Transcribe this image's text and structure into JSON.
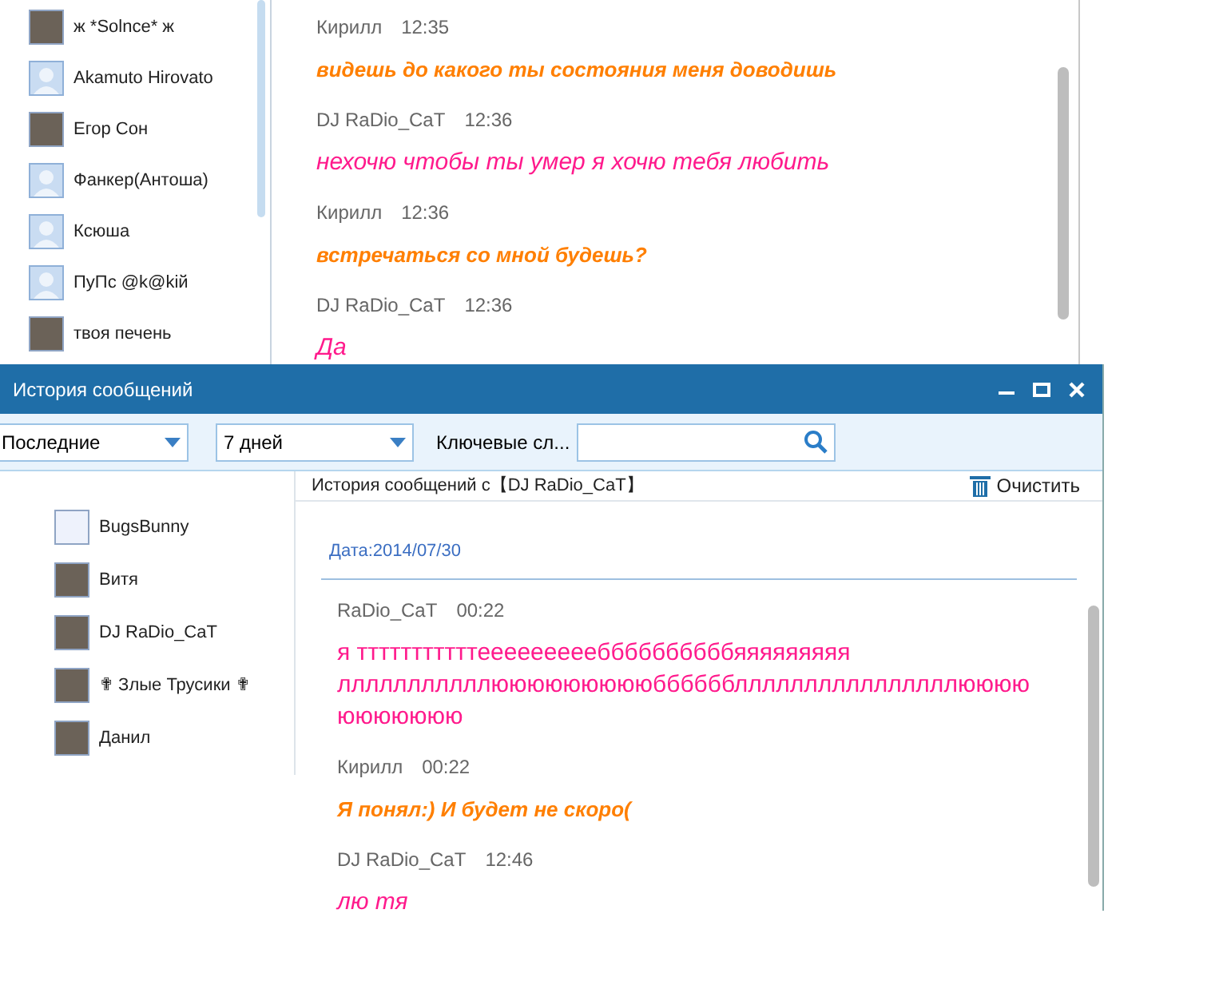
{
  "back_window": {
    "contacts": [
      {
        "name": "ж *Solnce* ж",
        "kind": "photo"
      },
      {
        "name": "Akamuto Hirovato",
        "kind": "default"
      },
      {
        "name": "Егор Сон",
        "kind": "photo"
      },
      {
        "name": "Фанкер(Антоша)",
        "kind": "default"
      },
      {
        "name": "Ксюша",
        "kind": "default"
      },
      {
        "name": "ПуПс @k@kiй",
        "kind": "default"
      },
      {
        "name": "твоя печень",
        "kind": "photo"
      }
    ],
    "messages": [
      {
        "sender": "Кирилл",
        "time": "12:35",
        "text": "видешь до какого ты состояния меня доводишь",
        "color": "#ff7f00",
        "kind": "bold-italic"
      },
      {
        "sender": "DJ RaDio_CaT",
        "time": "12:36",
        "text": "нехочю чтобы ты умер я хочю тебя любить",
        "color": "#ff1a8c",
        "kind": "italic"
      },
      {
        "sender": "Кирилл",
        "time": "12:36",
        "text": "встречаться со мной будешь?",
        "color": "#ff7f00",
        "kind": "bold-italic"
      },
      {
        "sender": "DJ RaDio_CaT",
        "time": "12:36",
        "text": "Да",
        "color": "#ff1a8c",
        "kind": "italic"
      }
    ]
  },
  "history_window": {
    "title": "История сообщений",
    "filter": {
      "value": "Последние"
    },
    "period": {
      "value": "7 дней"
    },
    "keywords_label": "Ключевые сл...",
    "contacts": [
      {
        "name": "BugsBunny",
        "kind": "blank"
      },
      {
        "name": "Витя",
        "kind": "photo"
      },
      {
        "name": "DJ RaDio_CaT",
        "kind": "photo"
      },
      {
        "name": "✟ Злые Трусики ✟",
        "kind": "photo"
      },
      {
        "name": "Данил",
        "kind": "photo"
      }
    ],
    "header": "История сообщений с【DJ RaDio_CaT】",
    "clear_button": "Очистить",
    "date": "Дата:2014/07/30",
    "messages": [
      {
        "sender": "RaDio_CaT",
        "time": "00:22",
        "text": "я тттттттттттеееееееееббббббббббяяяяяяяяя лллллллллллюююююююююббббббллллллллллллллллюююю ююююююю",
        "color": "#ff1a8c",
        "kind": "regular"
      },
      {
        "sender": "Кирилл",
        "time": "00:22",
        "text": "Я понял:) И будет не скоро(",
        "color": "#ff7f00",
        "kind": "bold-italic"
      },
      {
        "sender": "DJ RaDio_CaT",
        "time": "12:46",
        "text": "лю тя",
        "color": "#ff1a8c",
        "kind": "italic"
      }
    ]
  }
}
